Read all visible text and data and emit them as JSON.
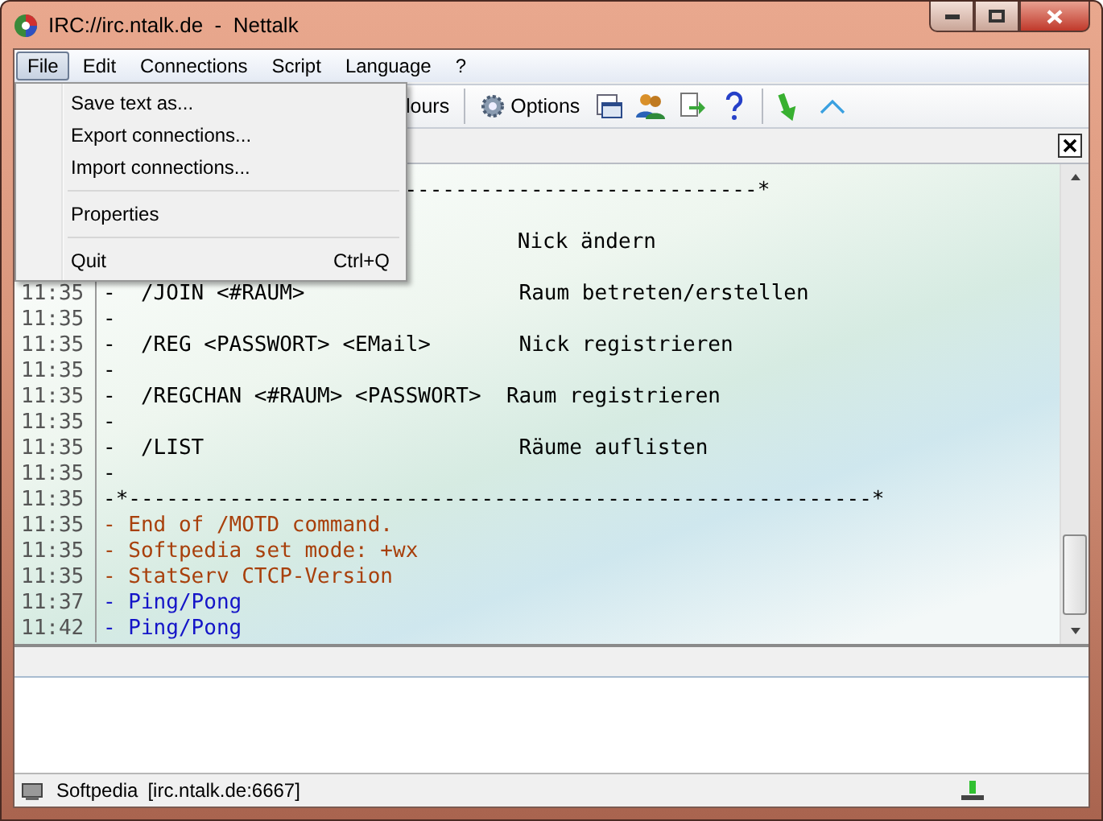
{
  "window": {
    "title": "IRC://irc.ntalk.de  -  Nettalk"
  },
  "menu_bar": [
    {
      "label": "File",
      "selected": true
    },
    {
      "label": "Edit",
      "selected": false
    },
    {
      "label": "Connections",
      "selected": false
    },
    {
      "label": "Script",
      "selected": false
    },
    {
      "label": "Language",
      "selected": false
    },
    {
      "label": "?",
      "selected": false
    }
  ],
  "file_menu": [
    {
      "kind": "item",
      "label": "Save text as..."
    },
    {
      "kind": "item",
      "label": "Export connections..."
    },
    {
      "kind": "item",
      "label": "Import connections..."
    },
    {
      "kind": "separator"
    },
    {
      "kind": "item",
      "label": "Properties"
    },
    {
      "kind": "separator"
    },
    {
      "kind": "item",
      "label": "Quit",
      "shortcut": "Ctrl+Q"
    }
  ],
  "toolbar": [
    {
      "kind": "text",
      "label": "lours"
    },
    {
      "kind": "separator"
    },
    {
      "kind": "icon-text",
      "label": "Options"
    },
    {
      "kind": "icon"
    },
    {
      "kind": "icon"
    },
    {
      "kind": "icon"
    },
    {
      "kind": "icon"
    },
    {
      "kind": "separator"
    },
    {
      "kind": "icon"
    },
    {
      "kind": "icon"
    }
  ],
  "log": [
    {
      "kind": "rule-tail",
      "color": "#000000",
      "text": "----------------------------*"
    },
    {
      "kind": "desc",
      "color": "#000000",
      "text": "Nick ändern"
    },
    {
      "kind": "line",
      "color": "#000000",
      "time": "11:35",
      "text": "-  /JOIN <#RAUM>                 Raum betreten/erstellen"
    },
    {
      "kind": "line",
      "color": "#000000",
      "time": "11:35",
      "text": "-"
    },
    {
      "kind": "line",
      "color": "#000000",
      "time": "11:35",
      "text": "-  /REG <PASSWORT> <EMail>       Nick registrieren"
    },
    {
      "kind": "line",
      "color": "#000000",
      "time": "11:35",
      "text": "-"
    },
    {
      "kind": "line",
      "color": "#000000",
      "time": "11:35",
      "text": "-  /REGCHAN <#RAUM> <PASSWORT>  Raum registrieren"
    },
    {
      "kind": "line",
      "color": "#000000",
      "time": "11:35",
      "text": "-"
    },
    {
      "kind": "line",
      "color": "#000000",
      "time": "11:35",
      "text": "-  /LIST                         Räume auflisten"
    },
    {
      "kind": "line",
      "color": "#000000",
      "time": "11:35",
      "text": "-"
    },
    {
      "kind": "line",
      "color": "#000000",
      "time": "11:35",
      "text": "-*-----------------------------------------------------------*"
    },
    {
      "kind": "line",
      "color": "#a8400c",
      "time": "11:35",
      "text": "- End of /MOTD command."
    },
    {
      "kind": "line",
      "color": "#a8400c",
      "time": "11:35",
      "text": "- Softpedia set mode: +wx"
    },
    {
      "kind": "line",
      "color": "#a8400c",
      "time": "11:35",
      "text": "- StatServ CTCP-Version"
    },
    {
      "kind": "line",
      "color": "#1414c8",
      "time": "11:37",
      "text": "- Ping/Pong"
    },
    {
      "kind": "line",
      "color": "#1414c8",
      "time": "11:42",
      "text": "- Ping/Pong"
    }
  ],
  "status_bar": {
    "nick": "Softpedia",
    "server": "[irc.ntalk.de:6667]"
  }
}
